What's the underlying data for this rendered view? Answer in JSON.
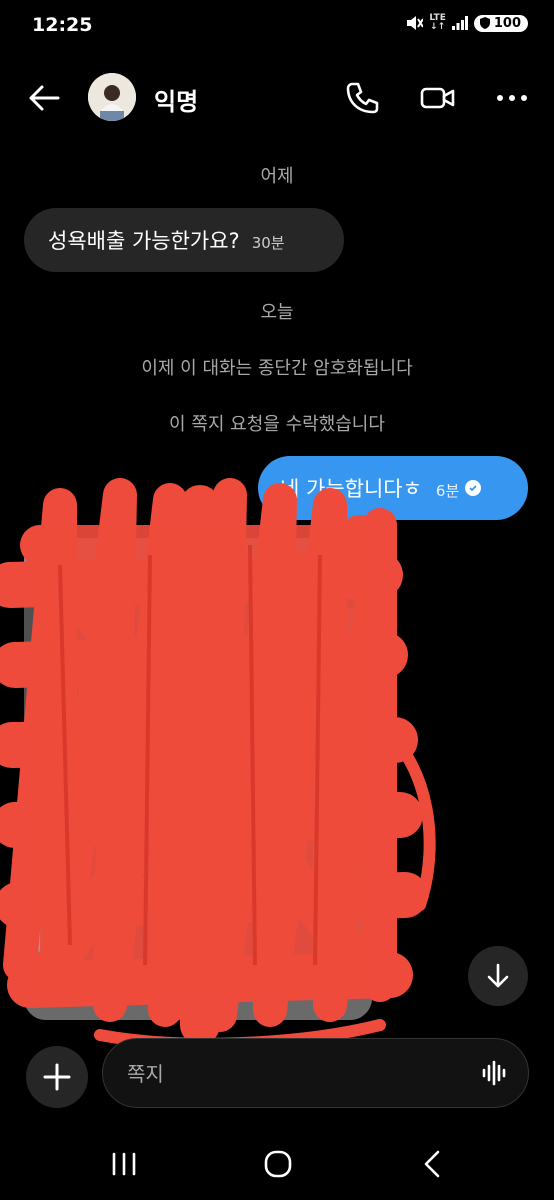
{
  "status_bar": {
    "time": "12:25",
    "network": "LTE",
    "battery": "100"
  },
  "header": {
    "contact_name": "익명"
  },
  "thread": {
    "yesterday_label": "어제",
    "incoming": {
      "text": "성욕배출 가능한가요?",
      "time": "30분"
    },
    "today_label": "오늘",
    "system_messages": [
      "이제 이 대화는 종단간 암호화됩니다",
      "이 쪽지 요청을 수락했습니다"
    ],
    "outgoing": {
      "text": "네 가능합니다ㅎ",
      "time": "6분"
    }
  },
  "composer": {
    "placeholder": "쪽지"
  },
  "colors": {
    "outgoing_bubble": "#3797f0",
    "incoming_bubble": "#262626",
    "redaction": "#ee4b3c"
  }
}
